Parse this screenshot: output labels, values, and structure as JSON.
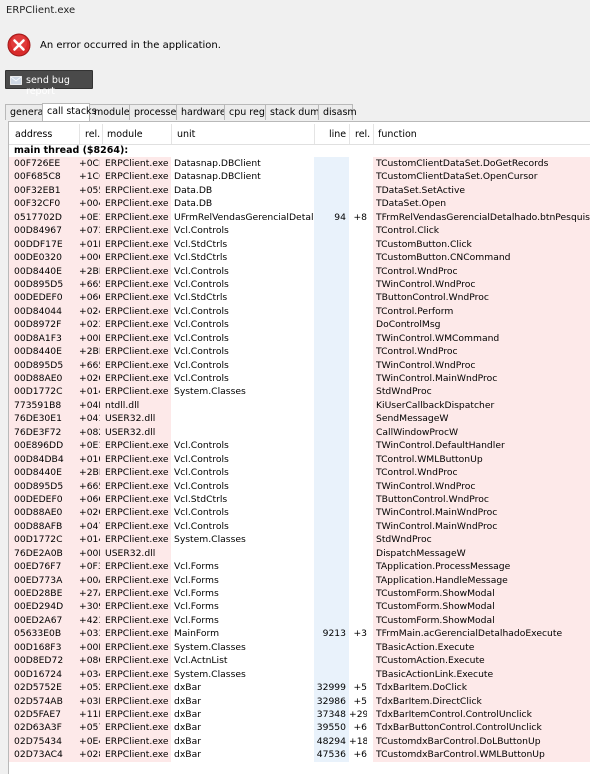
{
  "window": {
    "title": "ERPClient.exe"
  },
  "error": {
    "message": "An error occurred in the application."
  },
  "bug_button": {
    "label": "send bug report"
  },
  "tabs": [
    "general",
    "call stacks",
    "modules",
    "processes",
    "hardware",
    "cpu regs",
    "stack dump",
    "disasm"
  ],
  "active_tab": "call stacks",
  "columns": {
    "address": "address",
    "rel1": "rel.",
    "module": "module",
    "unit": "unit",
    "line": "line",
    "rel2": "rel.",
    "function": "function"
  },
  "thread_label": "main thread ($8264):",
  "rows": [
    [
      "00F726EE",
      "+0CE",
      "ERPClient.exe",
      "Datasnap.DBClient",
      "",
      "",
      "TCustomClientDataSet.DoGetRecords"
    ],
    [
      "00F685C8",
      "+1C0",
      "ERPClient.exe",
      "Datasnap.DBClient",
      "",
      "",
      "TCustomClientDataSet.OpenCursor"
    ],
    [
      "00F32EB1",
      "+055",
      "ERPClient.exe",
      "Data.DB",
      "",
      "",
      "TDataSet.SetActive"
    ],
    [
      "00F32CF0",
      "+004",
      "ERPClient.exe",
      "Data.DB",
      "",
      "",
      "TDataSet.Open"
    ],
    [
      "0517702D",
      "+0E1",
      "ERPClient.exe",
      "UFrmRelVendasGerencialDetalhado",
      "94",
      "+8",
      "TFrmRelVendasGerencialDetalhado.btnPesquisarClick"
    ],
    [
      "00D84967",
      "+073",
      "ERPClient.exe",
      "Vcl.Controls",
      "",
      "",
      "TControl.Click"
    ],
    [
      "00DDF17E",
      "+01E",
      "ERPClient.exe",
      "Vcl.StdCtrls",
      "",
      "",
      "TCustomButton.Click"
    ],
    [
      "00DE0320",
      "+00C",
      "ERPClient.exe",
      "Vcl.StdCtrls",
      "",
      "",
      "TCustomButton.CNCommand"
    ],
    [
      "00D8440E",
      "+2BE",
      "ERPClient.exe",
      "Vcl.Controls",
      "",
      "",
      "TControl.WndProc"
    ],
    [
      "00D895D5",
      "+665",
      "ERPClient.exe",
      "Vcl.Controls",
      "",
      "",
      "TWinControl.WndProc"
    ],
    [
      "00DEDEF0",
      "+06C",
      "ERPClient.exe",
      "Vcl.StdCtrls",
      "",
      "",
      "TButtonControl.WndProc"
    ],
    [
      "00D84044",
      "+024",
      "ERPClient.exe",
      "Vcl.Controls",
      "",
      "",
      "TControl.Perform"
    ],
    [
      "00D8972F",
      "+023",
      "ERPClient.exe",
      "Vcl.Controls",
      "",
      "",
      "DoControlMsg"
    ],
    [
      "00D8A1F3",
      "+00B",
      "ERPClient.exe",
      "Vcl.Controls",
      "",
      "",
      "TWinControl.WMCommand"
    ],
    [
      "00D8440E",
      "+2BE",
      "ERPClient.exe",
      "Vcl.Controls",
      "",
      "",
      "TControl.WndProc"
    ],
    [
      "00D895D5",
      "+665",
      "ERPClient.exe",
      "Vcl.Controls",
      "",
      "",
      "TWinControl.WndProc"
    ],
    [
      "00D88AE0",
      "+02C",
      "ERPClient.exe",
      "Vcl.Controls",
      "",
      "",
      "TWinControl.MainWndProc"
    ],
    [
      "00D1772C",
      "+014",
      "ERPClient.exe",
      "System.Classes",
      "",
      "",
      "StdWndProc"
    ],
    [
      "773591B8",
      "+04B",
      "ntdll.dll",
      "",
      "",
      "",
      "KiUserCallbackDispatcher"
    ],
    [
      "76DE30E1",
      "+041",
      "USER32.dll",
      "",
      "",
      "",
      "SendMessageW"
    ],
    [
      "76DE3F72",
      "+082",
      "USER32.dll",
      "",
      "",
      "",
      "CallWindowProcW"
    ],
    [
      "00E896DD",
      "+0E1",
      "ERPClient.exe",
      "Vcl.Controls",
      "",
      "",
      "TWinControl.DefaultHandler"
    ],
    [
      "00D84DB4",
      "+010",
      "ERPClient.exe",
      "Vcl.Controls",
      "",
      "",
      "TControl.WMLButtonUp"
    ],
    [
      "00D8440E",
      "+2BE",
      "ERPClient.exe",
      "Vcl.Controls",
      "",
      "",
      "TControl.WndProc"
    ],
    [
      "00D895D5",
      "+665",
      "ERPClient.exe",
      "Vcl.Controls",
      "",
      "",
      "TWinControl.WndProc"
    ],
    [
      "00DEDEF0",
      "+06C",
      "ERPClient.exe",
      "Vcl.StdCtrls",
      "",
      "",
      "TButtonControl.WndProc"
    ],
    [
      "00D88AE0",
      "+02C",
      "ERPClient.exe",
      "Vcl.Controls",
      "",
      "",
      "TWinControl.MainWndProc"
    ],
    [
      "00D88AFB",
      "+047",
      "ERPClient.exe",
      "Vcl.Controls",
      "",
      "",
      "TWinControl.MainWndProc"
    ],
    [
      "00D1772C",
      "+014",
      "ERPClient.exe",
      "System.Classes",
      "",
      "",
      "StdWndProc"
    ],
    [
      "76DE2A0B",
      "+00B",
      "USER32.dll",
      "",
      "",
      "",
      "DispatchMessageW"
    ],
    [
      "00ED76F7",
      "+0F3",
      "ERPClient.exe",
      "Vcl.Forms",
      "",
      "",
      "TApplication.ProcessMessage"
    ],
    [
      "00ED773A",
      "+00A",
      "ERPClient.exe",
      "Vcl.Forms",
      "",
      "",
      "TApplication.HandleMessage"
    ],
    [
      "00ED28BE",
      "+27A",
      "ERPClient.exe",
      "Vcl.Forms",
      "",
      "",
      "TCustomForm.ShowModal"
    ],
    [
      "00ED294D",
      "+309",
      "ERPClient.exe",
      "Vcl.Forms",
      "",
      "",
      "TCustomForm.ShowModal"
    ],
    [
      "00ED2A67",
      "+423",
      "ERPClient.exe",
      "Vcl.Forms",
      "",
      "",
      "TCustomForm.ShowModal"
    ],
    [
      "05633E0B",
      "+033",
      "ERPClient.exe",
      "MainForm",
      "9213",
      "+3",
      "TFrmMain.acGerencialDetalhadoExecute"
    ],
    [
      "00D168F3",
      "+00F",
      "ERPClient.exe",
      "System.Classes",
      "",
      "",
      "TBasicAction.Execute"
    ],
    [
      "00D8ED72",
      "+086",
      "ERPClient.exe",
      "Vcl.ActnList",
      "",
      "",
      "TCustomAction.Execute"
    ],
    [
      "00D16724",
      "+034",
      "ERPClient.exe",
      "System.Classes",
      "",
      "",
      "TBasicActionLink.Execute"
    ],
    [
      "02D5752E",
      "+052",
      "ERPClient.exe",
      "dxBar",
      "32999",
      "+5",
      "TdxBarItem.DoClick"
    ],
    [
      "02D574AB",
      "+03B",
      "ERPClient.exe",
      "dxBar",
      "32986",
      "+5",
      "TdxBarItem.DirectClick"
    ],
    [
      "02D5FAE7",
      "+11F",
      "ERPClient.exe",
      "dxBar",
      "37348",
      "+29",
      "TdxBarItemControl.ControlUnclick"
    ],
    [
      "02D63A3F",
      "+057",
      "ERPClient.exe",
      "dxBar",
      "39550",
      "+6",
      "TdxBarButtonControl.ControlUnclick"
    ],
    [
      "02D75434",
      "+0E4",
      "ERPClient.exe",
      "dxBar",
      "48294",
      "+18",
      "TCustomdxBarControl.DoLButtonUp"
    ],
    [
      "02D73AC4",
      "+028",
      "ERPClient.exe",
      "dxBar",
      "47536",
      "+6",
      "TCustomdxBarControl.WMLButtonUp"
    ]
  ],
  "colors": {
    "row_bg": "#fde9e9",
    "line_col_bg": "#e9f2fb",
    "button_bg": "#4a4a4a",
    "error_red": "#d92b2b"
  }
}
